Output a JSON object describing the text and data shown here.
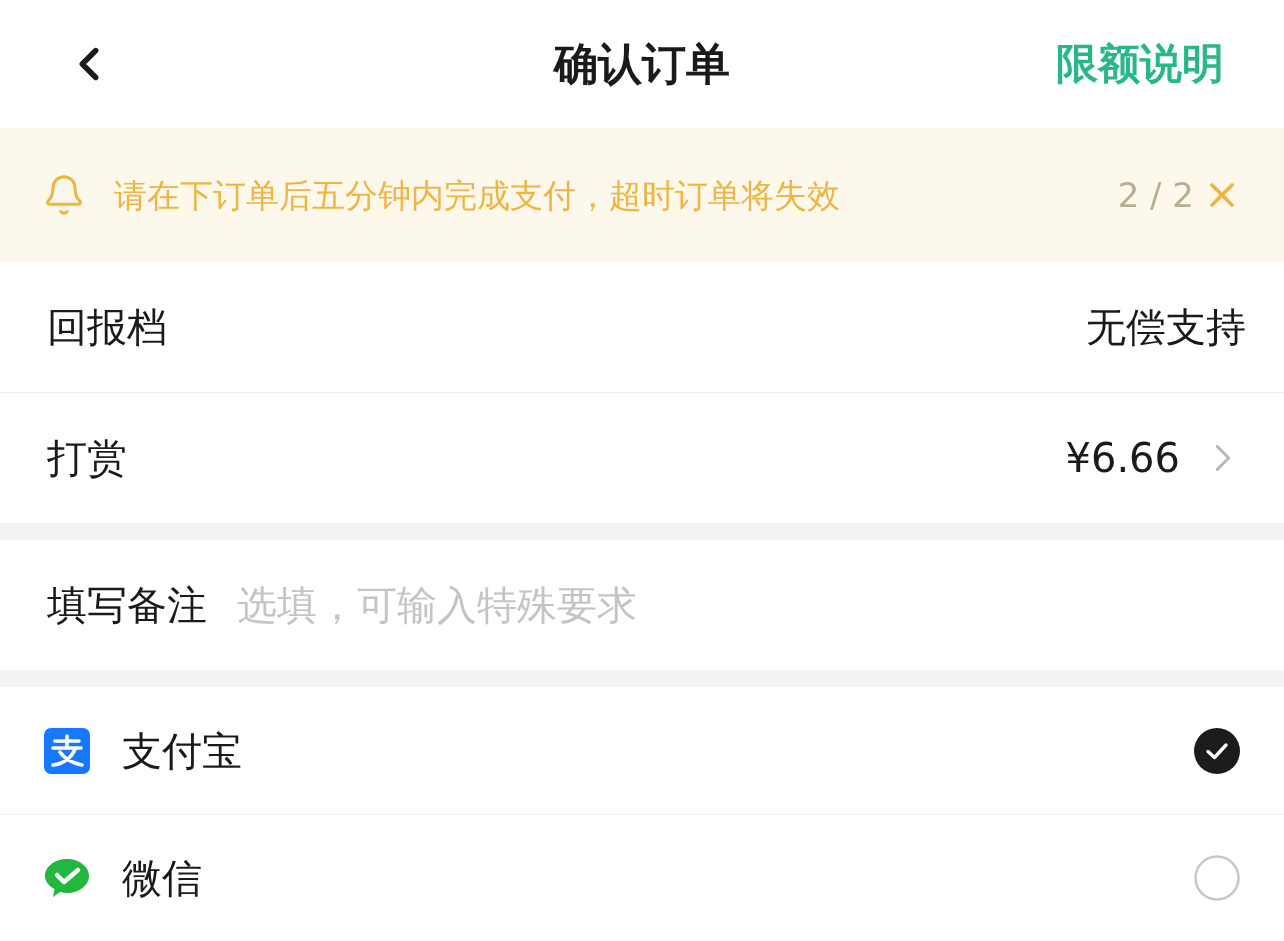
{
  "header": {
    "title": "确认订单",
    "action": "限额说明"
  },
  "notice": {
    "text": "请在下订单后五分钟内完成支付，超时订单将失效",
    "counter": "2 / 2"
  },
  "order_rows": [
    {
      "label": "回报档",
      "value": "无偿支持",
      "kind": "plain"
    },
    {
      "label": "打赏",
      "value": "¥6.66",
      "kind": "link"
    }
  ],
  "remark": {
    "label": "填写备注",
    "placeholder": "选填，可输入特殊要求"
  },
  "payment_methods": [
    {
      "name": "支付宝",
      "kind": "alipay",
      "selected": true
    },
    {
      "name": "微信",
      "kind": "wechat",
      "selected": false
    }
  ]
}
